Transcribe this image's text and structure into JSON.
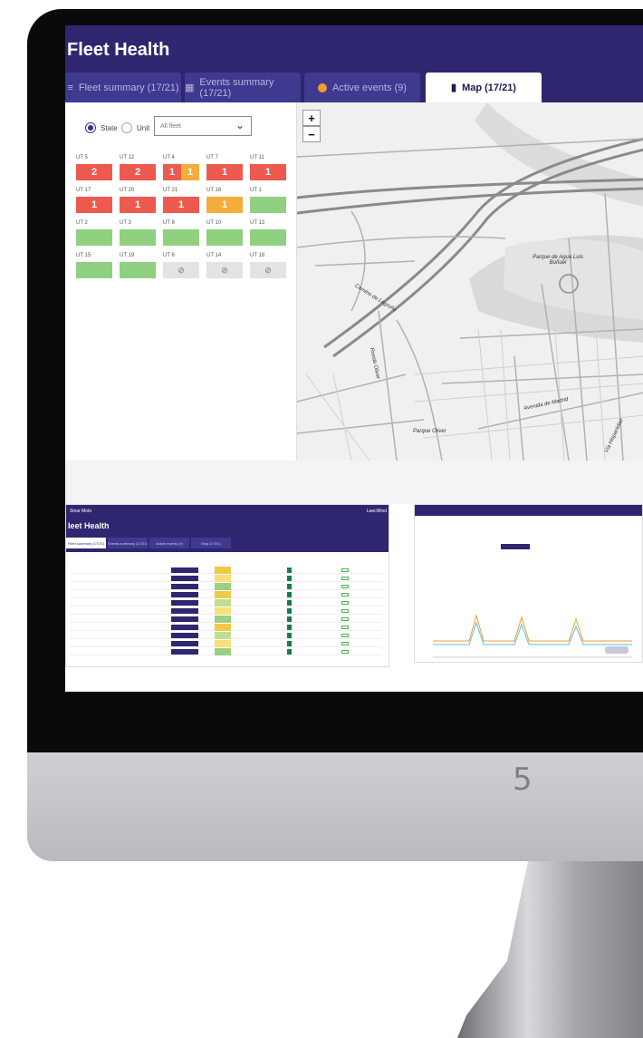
{
  "app": {
    "title": "Fleet Health",
    "tabs": [
      {
        "label": "Fleet summary (17/21)",
        "icon": "list-icon"
      },
      {
        "label": "Events summary (17/21)",
        "icon": "calendar-icon"
      },
      {
        "label": "Active events (9)",
        "icon": "alert-dot-icon"
      },
      {
        "label": "Map (17/21)",
        "icon": "map-icon",
        "active": true
      }
    ]
  },
  "filters": {
    "radio_state": "State",
    "radio_unit": "Unit",
    "fleet_select": "All fleet"
  },
  "units": [
    {
      "label": "UT 5",
      "tiles": [
        {
          "color": "red",
          "text": "2"
        }
      ]
    },
    {
      "label": "UT 12",
      "tiles": [
        {
          "color": "red",
          "text": "2"
        }
      ]
    },
    {
      "label": "UT 4",
      "tiles": [
        {
          "color": "red",
          "text": "1"
        },
        {
          "color": "orange",
          "text": "1"
        }
      ]
    },
    {
      "label": "UT 7",
      "tiles": [
        {
          "color": "red",
          "text": "1"
        }
      ]
    },
    {
      "label": "UT 11",
      "tiles": [
        {
          "color": "red",
          "text": "1"
        }
      ]
    },
    {
      "label": "UT 17",
      "tiles": [
        {
          "color": "red",
          "text": "1"
        }
      ]
    },
    {
      "label": "UT 20",
      "tiles": [
        {
          "color": "red",
          "text": "1"
        }
      ]
    },
    {
      "label": "UT 21",
      "tiles": [
        {
          "color": "red",
          "text": "1"
        }
      ]
    },
    {
      "label": "UT 16",
      "tiles": [
        {
          "color": "orange",
          "text": "1"
        }
      ]
    },
    {
      "label": "UT 1",
      "tiles": [
        {
          "color": "green",
          "text": ""
        }
      ]
    },
    {
      "label": "UT 2",
      "tiles": [
        {
          "color": "green",
          "text": ""
        }
      ]
    },
    {
      "label": "UT 3",
      "tiles": [
        {
          "color": "green",
          "text": ""
        }
      ]
    },
    {
      "label": "UT 8",
      "tiles": [
        {
          "color": "green",
          "text": ""
        }
      ]
    },
    {
      "label": "UT 10",
      "tiles": [
        {
          "color": "green",
          "text": ""
        }
      ]
    },
    {
      "label": "UT 13",
      "tiles": [
        {
          "color": "green",
          "text": ""
        }
      ]
    },
    {
      "label": "UT 15",
      "tiles": [
        {
          "color": "green",
          "text": ""
        }
      ]
    },
    {
      "label": "UT 19",
      "tiles": [
        {
          "color": "green",
          "text": ""
        }
      ]
    },
    {
      "label": "UT 6",
      "tiles": [
        {
          "color": "grey",
          "text": "⊘"
        }
      ]
    },
    {
      "label": "UT 14",
      "tiles": [
        {
          "color": "grey",
          "text": "⊘"
        }
      ]
    },
    {
      "label": "UT 18",
      "tiles": [
        {
          "color": "grey",
          "text": "⊘"
        }
      ]
    }
  ],
  "map": {
    "zoom_in": "+",
    "zoom_out": "−",
    "labels": [
      {
        "text": "Parque de Agua Luis Buñuel"
      },
      {
        "text": "Camino de Logroño"
      },
      {
        "text": "Ronda Oliver"
      },
      {
        "text": "Parque Oliver"
      },
      {
        "text": "Avenida de Madrid"
      },
      {
        "text": "Vía Hispanidad"
      }
    ]
  },
  "thumbnails": {
    "table_view": {
      "brand": "Sinar Moto",
      "title": "leet Health",
      "brand_right": "LaecWind",
      "tabs": [
        "Fleet summary (17/21)",
        "Events summary (17/21)",
        "Active events (9)",
        "Map (17/21)"
      ]
    }
  },
  "monitor": {
    "page_number": "5"
  },
  "colors": {
    "header": "#2e2770",
    "red": "#ec5a4f",
    "orange": "#f4ac3d",
    "green": "#8fd081",
    "grey": "#e3e3e3"
  }
}
